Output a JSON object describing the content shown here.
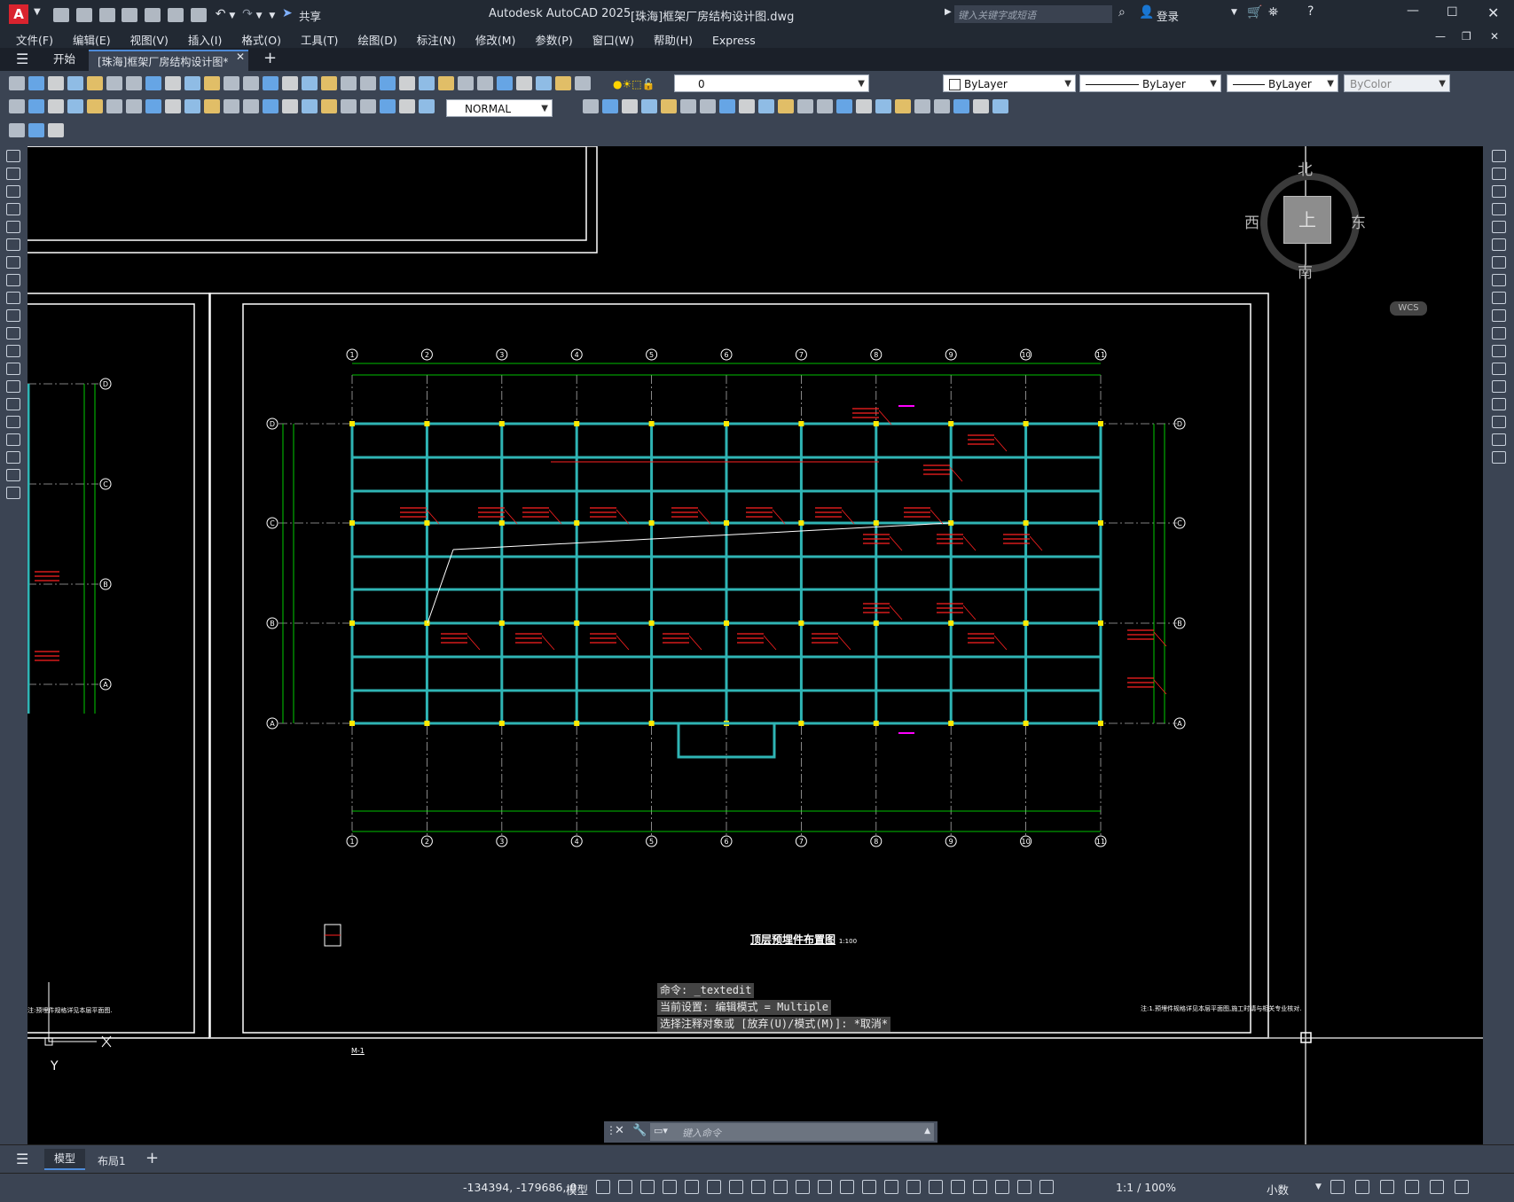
{
  "app": {
    "title": "Autodesk AutoCAD 2025",
    "doc_title": "[珠海]框架厂房结构设计图.dwg",
    "share_label": "共享",
    "search_placeholder": "键入关键字或短语",
    "login_label": "登录"
  },
  "menu": [
    "文件(F)",
    "编辑(E)",
    "视图(V)",
    "插入(I)",
    "格式(O)",
    "工具(T)",
    "绘图(D)",
    "标注(N)",
    "修改(M)",
    "参数(P)",
    "窗口(W)",
    "帮助(H)",
    "Express"
  ],
  "doc_tabs": {
    "start": "开始",
    "active": "[珠海]框架厂房结构设计图*"
  },
  "ribbon": {
    "layer_value": "0",
    "color_value": "ByLayer",
    "linetype_value": "ByLayer",
    "lineweight_value": "ByLayer",
    "plotstyle_value": "ByColor",
    "dimstyle_value": "NORMAL"
  },
  "viewcube": {
    "north": "北",
    "south": "南",
    "east": "东",
    "west": "西",
    "face": "上",
    "wcs": "WCS"
  },
  "drawing": {
    "title": "顶层预埋件布置图",
    "scale": "1:100",
    "axes_top": [
      "1",
      "2",
      "3",
      "4",
      "5",
      "6",
      "7",
      "8",
      "9",
      "10",
      "11"
    ],
    "axes_side": [
      "D",
      "C",
      "B",
      "A"
    ],
    "note_right": "注:1.预埋件规格详见本层平面图,施工时请与相关专业核对.",
    "note_left": "注:预埋件规格详见本层平面图.",
    "detail_label": "M-1",
    "ucs_y": "Y"
  },
  "command": {
    "history": [
      "命令: _textedit",
      "当前设置: 编辑模式 = Multiple",
      "选择注释对象或 [放弃(U)/模式(M)]: *取消*"
    ],
    "placeholder": "键入命令"
  },
  "layout_tabs": [
    "模型",
    "布局1"
  ],
  "status": {
    "coords": "-134394, -179686, 0",
    "mode": "模型",
    "scale": "1:1 / 100%",
    "units": "小数"
  },
  "colors": {
    "canvas": "#000000",
    "beam": "#2fb5b5",
    "axis": "#ffffff",
    "annot": "#ff2020",
    "dim": "#00ff00"
  }
}
